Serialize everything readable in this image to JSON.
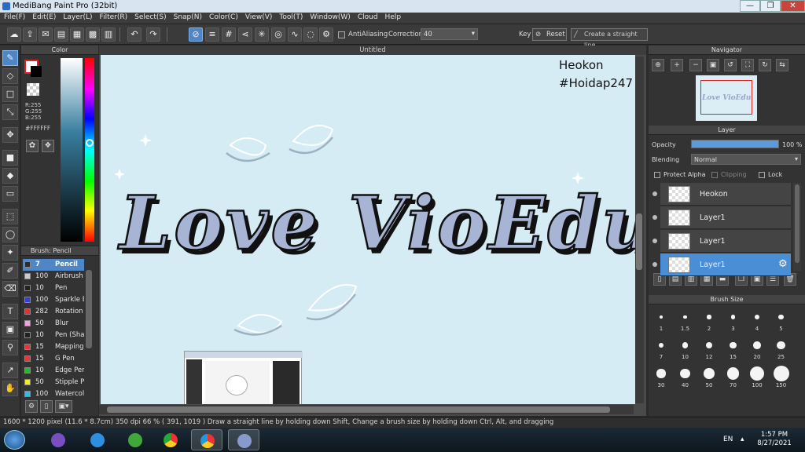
{
  "window": {
    "title": "MediBang Paint Pro (32bit)",
    "min": "—",
    "max": "❐",
    "close": "✕"
  },
  "menu": [
    "File(F)",
    "Edit(E)",
    "Layer(L)",
    "Filter(R)",
    "Select(S)",
    "Snap(N)",
    "Color(C)",
    "View(V)",
    "Tool(T)",
    "Window(W)",
    "Cloud",
    "Help"
  ],
  "toolbar": {
    "antialiasing_label": "AntiAliasing",
    "correction_label": "Correction",
    "correction_value": "40",
    "key_label": "Key",
    "reset_label": "Reset",
    "straight_line_label": "Create a straight line"
  },
  "color_panel": {
    "title": "Color",
    "r": "R:255",
    "g": "G:255",
    "b": "B:255",
    "hex": "#FFFFFF",
    "primary": "#ffffff",
    "secondary": "#000000"
  },
  "brush_panel": {
    "title": "Brush: Pencil",
    "items": [
      {
        "size": "7",
        "name": "Pencil",
        "color": "#2b2b2b"
      },
      {
        "size": "100",
        "name": "Airbrush",
        "color": "#cccccc"
      },
      {
        "size": "10",
        "name": "Pen",
        "color": "#222222"
      },
      {
        "size": "100",
        "name": "Sparkle B",
        "color": "#3b3bdd"
      },
      {
        "size": "282",
        "name": "Rotation",
        "color": "#dd3333"
      },
      {
        "size": "50",
        "name": "Blur",
        "color": "#f3a0e0"
      },
      {
        "size": "10",
        "name": "Pen (Sha",
        "color": "#222222"
      },
      {
        "size": "15",
        "name": "Mapping P",
        "color": "#ee3333"
      },
      {
        "size": "15",
        "name": "G Pen",
        "color": "#ee3333"
      },
      {
        "size": "10",
        "name": "Edge Pen",
        "color": "#22bb22"
      },
      {
        "size": "50",
        "name": "Stipple Pe",
        "color": "#eeee22"
      },
      {
        "size": "100",
        "name": "Watercol",
        "color": "#33bbee"
      }
    ]
  },
  "document": {
    "tab_title": "Untitled",
    "watermark_line1": "Heokon",
    "watermark_line2": "#Hoidap247",
    "artwork_text": "Love VioEdu"
  },
  "navigator": {
    "title": "Navigator"
  },
  "layer_panel": {
    "title": "Layer",
    "opacity_label": "Opacity",
    "opacity_value": "100 %",
    "opacity_fraction": 1.0,
    "blending_label": "Blending",
    "blending_value": "Normal",
    "protect_alpha": "Protect Alpha",
    "clipping": "Clipping",
    "lock": "Lock",
    "layers": [
      {
        "name": "Heokon",
        "selected": false
      },
      {
        "name": "Layer1",
        "selected": false
      },
      {
        "name": "Layer1",
        "selected": false
      },
      {
        "name": "Layer1",
        "selected": true
      }
    ]
  },
  "brush_size_panel": {
    "title": "Brush Size",
    "sizes": [
      "1",
      "1.5",
      "2",
      "3",
      "4",
      "5",
      "7",
      "10",
      "12",
      "15",
      "20",
      "25",
      "30",
      "40",
      "50",
      "70",
      "100",
      "150"
    ]
  },
  "status": {
    "text": "1600 * 1200 pixel   (11.6 * 8.7cm)   350 dpi   66 %   ( 391, 1019 )   Draw a straight line by holding down Shift, Change a brush size by holding down Ctrl, Alt, and dragging"
  },
  "taskbar": {
    "lang": "EN",
    "time": "1:57 PM",
    "date": "8/27/2021"
  }
}
